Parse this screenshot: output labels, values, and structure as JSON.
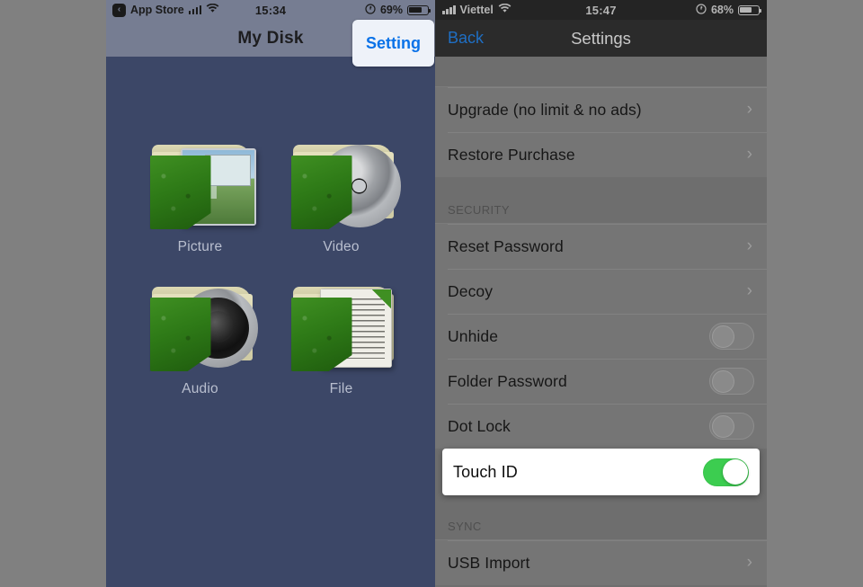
{
  "left_phone": {
    "statusbar": {
      "back_chip": "‹",
      "carrier_or_app": "App Store",
      "signal_icon": "cellular-bars-icon",
      "wifi_icon": "wifi-icon",
      "time": "15:34",
      "rotation_lock_icon": "rotation-lock-icon",
      "battery_percent": "69%",
      "battery_icon": "battery-icon"
    },
    "navbar": {
      "title": "My Disk",
      "setting_label": "Setting"
    },
    "grid": [
      {
        "label": "Picture",
        "icon": "picture-folder-icon"
      },
      {
        "label": "Video",
        "icon": "video-folder-icon"
      },
      {
        "label": "Audio",
        "icon": "audio-folder-icon"
      },
      {
        "label": "File",
        "icon": "file-folder-icon"
      }
    ]
  },
  "right_phone": {
    "statusbar": {
      "signal_icon": "cellular-bars-icon",
      "carrier": "Viettel",
      "wifi_icon": "wifi-icon",
      "time": "15:47",
      "rotation_lock_icon": "rotation-lock-icon",
      "battery_percent": "68%",
      "battery_icon": "battery-icon"
    },
    "navbar": {
      "back_label": "Back",
      "title": "Settings"
    },
    "rows": {
      "upgrade": {
        "label": "Upgrade (no limit & no ads)",
        "accessory": "chevron"
      },
      "restore": {
        "label": "Restore Purchase",
        "accessory": "chevron"
      },
      "security_header": "SECURITY",
      "reset_password": {
        "label": "Reset Password",
        "accessory": "chevron"
      },
      "decoy": {
        "label": "Decoy",
        "accessory": "chevron"
      },
      "unhide": {
        "label": "Unhide",
        "accessory": "toggle",
        "value": "off"
      },
      "folder_password": {
        "label": "Folder Password",
        "accessory": "toggle",
        "value": "off"
      },
      "dot_lock": {
        "label": "Dot Lock",
        "accessory": "toggle",
        "value": "off"
      },
      "touch_id": {
        "label": "Touch ID",
        "accessory": "toggle",
        "value": "on"
      },
      "sync_header": "SYNC",
      "usb_import": {
        "label": "USB Import",
        "accessory": "chevron"
      }
    }
  },
  "glyphs": {
    "chevron_right": "›"
  },
  "colors": {
    "backdrop": "#808080",
    "left_wallpaper": "#3c4767",
    "accent_blue": "#0a72e8",
    "toggle_on_green": "#3ccd50",
    "highlight_white": "#ffffff"
  }
}
